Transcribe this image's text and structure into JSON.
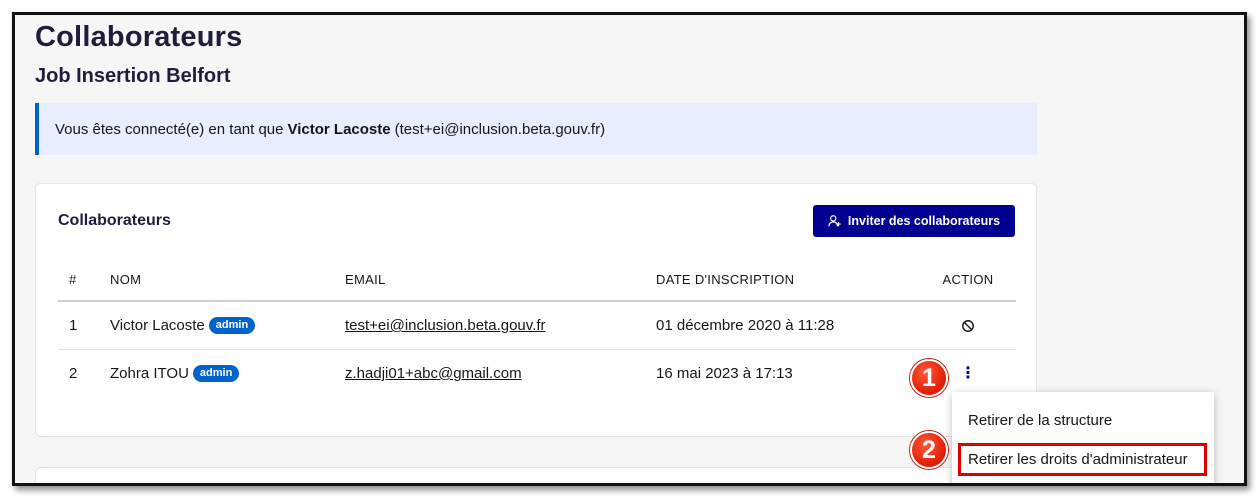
{
  "page": {
    "title": "Collaborateurs",
    "subtitle": "Job Insertion Belfort"
  },
  "notice": {
    "prefix": "Vous êtes connecté(e) en tant que",
    "user_name": "Victor Lacoste",
    "suffix": "(test+ei@inclusion.beta.gouv.fr)"
  },
  "card": {
    "title": "Collaborateurs",
    "invite_label": "Inviter des collaborateurs"
  },
  "table": {
    "headers": {
      "num": "#",
      "nom": "NOM",
      "email": "EMAIL",
      "date": "DATE D'INSCRIPTION",
      "action": "ACTION"
    },
    "rows": [
      {
        "num": "1",
        "nom": "Victor Lacoste",
        "badge": "admin",
        "email": "test+ei@inclusion.beta.gouv.fr",
        "date": "01 décembre 2020 à 11:28",
        "action_icon": "ban-icon"
      },
      {
        "num": "2",
        "nom": "Zohra ITOU",
        "badge": "admin",
        "email": "z.hadji01+abc@gmail.com",
        "date": "16 mai 2023 à 17:13",
        "action_icon": "kebab-menu-icon"
      }
    ]
  },
  "menu": {
    "items": [
      "Retirer de la structure",
      "Retirer les droits d'administrateur"
    ]
  },
  "steps": [
    "1",
    "2"
  ],
  "colors": {
    "primary": "#000091",
    "badge": "#0063cb",
    "notice_bg": "#e8edff",
    "highlight": "#e00000"
  }
}
